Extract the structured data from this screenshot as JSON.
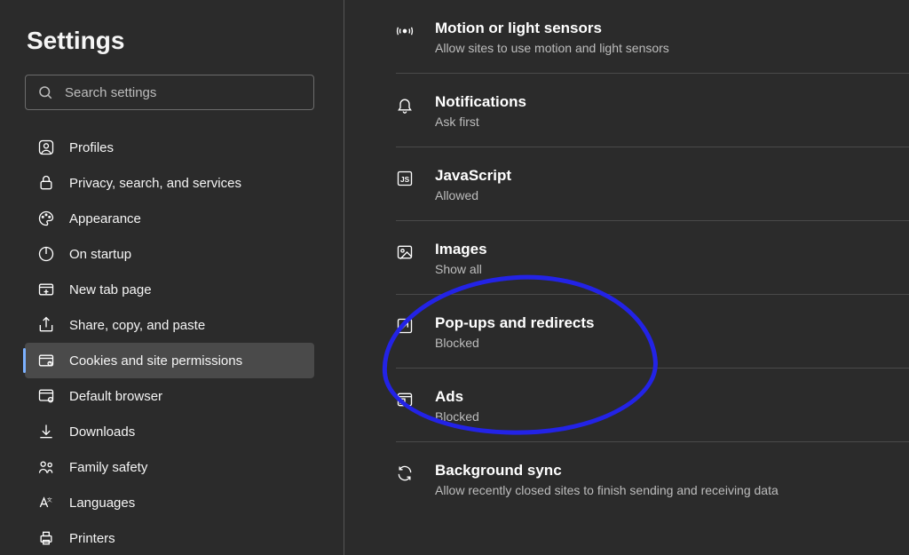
{
  "page_title": "Settings",
  "search": {
    "placeholder": "Search settings"
  },
  "sidebar": {
    "items": [
      {
        "icon": "profile-icon",
        "label": "Profiles"
      },
      {
        "icon": "lock-icon",
        "label": "Privacy, search, and services"
      },
      {
        "icon": "appearance-icon",
        "label": "Appearance"
      },
      {
        "icon": "power-icon",
        "label": "On startup"
      },
      {
        "icon": "tab-icon",
        "label": "New tab page"
      },
      {
        "icon": "share-icon",
        "label": "Share, copy, and paste"
      },
      {
        "icon": "cookies-icon",
        "label": "Cookies and site permissions"
      },
      {
        "icon": "browser-icon",
        "label": "Default browser"
      },
      {
        "icon": "download-icon",
        "label": "Downloads"
      },
      {
        "icon": "family-icon",
        "label": "Family safety"
      },
      {
        "icon": "languages-icon",
        "label": "Languages"
      },
      {
        "icon": "printer-icon",
        "label": "Printers"
      }
    ],
    "selected_index": 6
  },
  "permissions": [
    {
      "icon": "motion-icon",
      "title": "Motion or light sensors",
      "subtitle": "Allow sites to use motion and light sensors"
    },
    {
      "icon": "bell-icon",
      "title": "Notifications",
      "subtitle": "Ask first"
    },
    {
      "icon": "js-icon",
      "title": "JavaScript",
      "subtitle": "Allowed"
    },
    {
      "icon": "image-icon",
      "title": "Images",
      "subtitle": "Show all"
    },
    {
      "icon": "popup-icon",
      "title": "Pop-ups and redirects",
      "subtitle": "Blocked"
    },
    {
      "icon": "ads-icon",
      "title": "Ads",
      "subtitle": "Blocked"
    },
    {
      "icon": "sync-icon",
      "title": "Background sync",
      "subtitle": "Allow recently closed sites to finish sending and receiving data"
    }
  ],
  "annotation": {
    "color": "#2323e6",
    "covers": [
      "Pop-ups and redirects",
      "Ads"
    ]
  }
}
